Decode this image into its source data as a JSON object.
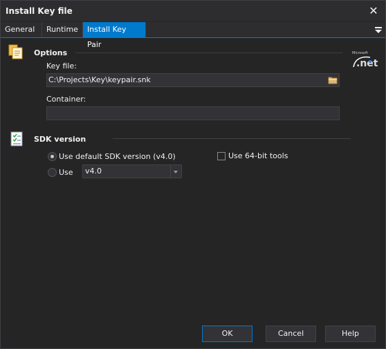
{
  "window": {
    "title": "Install Key file"
  },
  "tabs": [
    {
      "label": "General"
    },
    {
      "label": "Runtime"
    },
    {
      "label": "Install Key Pair",
      "active": true
    }
  ],
  "options": {
    "heading": "Options",
    "key_file_label": "Key file:",
    "key_file_value": "C:\\Projects\\Key\\keypair.snk",
    "container_label": "Container:",
    "container_value": ""
  },
  "sdk": {
    "heading": "SDK version",
    "use_default_label": "Use default SDK version (v4.0)",
    "use_default_checked": true,
    "use_label": "Use",
    "use_checked": false,
    "version_value": "v4.0",
    "use_64bit_label": "Use 64-bit tools",
    "use_64bit_checked": false
  },
  "buttons": {
    "ok": "OK",
    "cancel": "Cancel",
    "help": "Help"
  },
  "icons": {
    "close": "close-icon",
    "tab_menu": "hamburger-menu-icon",
    "options": "documents-icon",
    "sdk": "checklist-icon",
    "browse": "folder-icon",
    "logo": "dotnet-logo"
  },
  "colors": {
    "accent": "#007acc",
    "background": "#252526"
  }
}
